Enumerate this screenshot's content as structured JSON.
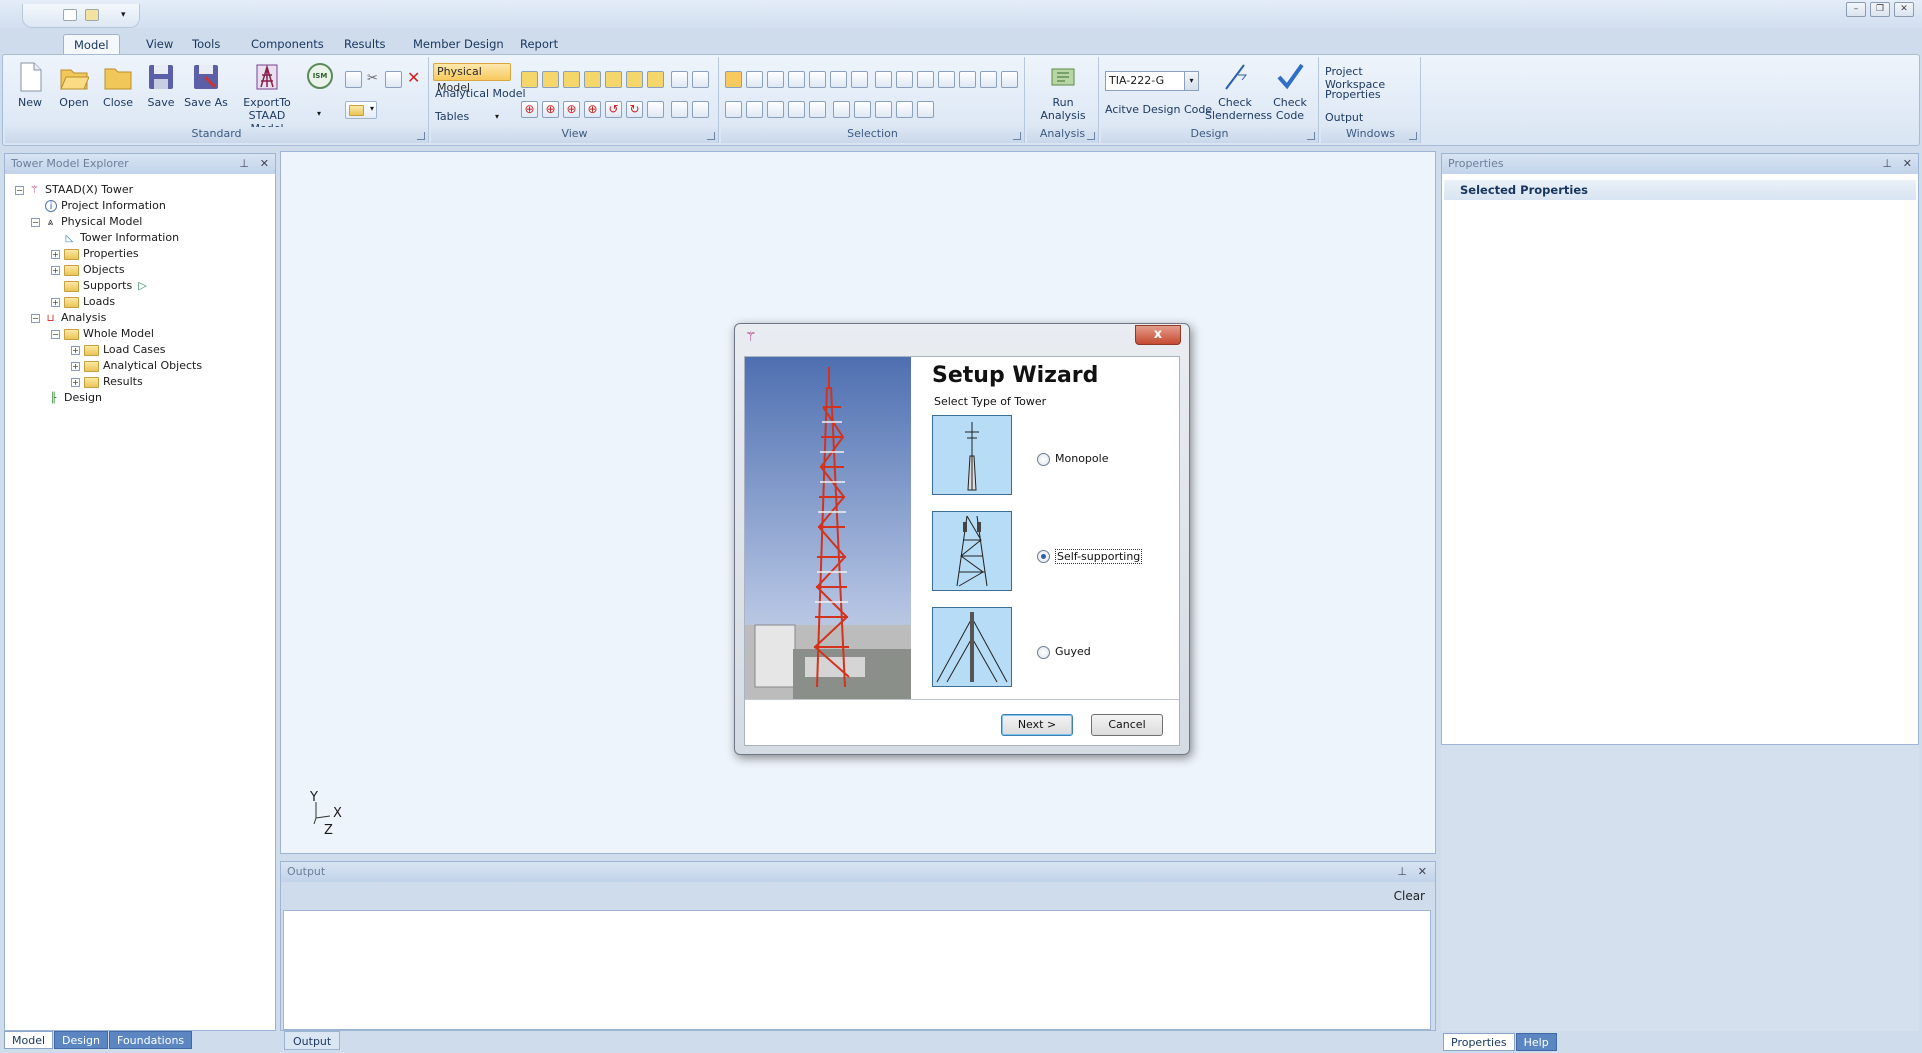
{
  "ribbon_tabs": [
    "Model",
    "View",
    "Tools",
    "Components",
    "Results",
    "Member Design",
    "Report"
  ],
  "standard": {
    "new": "New",
    "open": "Open",
    "close": "Close",
    "save": "Save",
    "save_as": "Save As",
    "export_line1": "ExportTo",
    "export_line2": "STAAD Model",
    "ism": "ISM",
    "group": "Standard"
  },
  "view_group": {
    "physical": "Physical Model",
    "analytical": "Analytical Model",
    "tables": "Tables",
    "group": "View"
  },
  "selection_group": "Selection",
  "analysis_group": {
    "run": "Run Analysis",
    "group": "Analysis"
  },
  "design_group": {
    "code_value": "TIA-222-G",
    "active_code": "Acitve Design Code",
    "check_slender_1": "Check",
    "check_slender_2": "Slenderness",
    "check_code_1": "Check",
    "check_code_2": "Code",
    "group": "Design"
  },
  "windows_group": {
    "workspace": "Project Workspace",
    "properties": "Properties",
    "output": "Output",
    "group": "Windows"
  },
  "explorer": {
    "title": "Tower Model Explorer",
    "nodes": [
      {
        "label": "STAAD(X) Tower"
      },
      {
        "label": "Project Information"
      },
      {
        "label": "Physical Model"
      },
      {
        "label": "Tower Information"
      },
      {
        "label": "Properties"
      },
      {
        "label": "Objects"
      },
      {
        "label": "Supports"
      },
      {
        "label": "Loads"
      },
      {
        "label": "Analysis"
      },
      {
        "label": "Whole Model"
      },
      {
        "label": "Load Cases"
      },
      {
        "label": "Analytical Objects"
      },
      {
        "label": "Results"
      },
      {
        "label": "Design"
      }
    ],
    "bottom_tabs": [
      "Model",
      "Design",
      "Foundations"
    ]
  },
  "axis": {
    "y": "Y",
    "x": "X",
    "z": "Z"
  },
  "output": {
    "title": "Output",
    "clear": "Clear",
    "tab": "Output"
  },
  "properties": {
    "title": "Properties",
    "section": "Selected Properties",
    "tabs": [
      "Properties",
      "Help"
    ]
  },
  "wizard": {
    "title": "Setup Wizard",
    "subtitle": "Select Type of Tower",
    "options": [
      {
        "label": "Monopole",
        "selected": false
      },
      {
        "label": "Self-supporting",
        "selected": true
      },
      {
        "label": "Guyed",
        "selected": false
      }
    ],
    "next": "Next >",
    "cancel": "Cancel",
    "close": "x"
  }
}
